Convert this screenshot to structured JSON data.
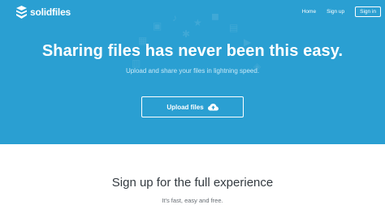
{
  "brand": {
    "name": "solidfiles",
    "color": "#2a9fd2",
    "logo_icon": "solidfiles-s-logo-icon"
  },
  "nav": {
    "home": "Home",
    "signup": "Sign up",
    "signin": "Sign in"
  },
  "hero": {
    "title": "Sharing files has never been this easy.",
    "subtitle": "Upload and share your files in lightning speed.",
    "upload_label": "Upload files",
    "upload_icon": "cloud-upload-icon"
  },
  "signup_section": {
    "title": "Sign up for the full experience",
    "subtitle": "It's fast, easy and free."
  }
}
